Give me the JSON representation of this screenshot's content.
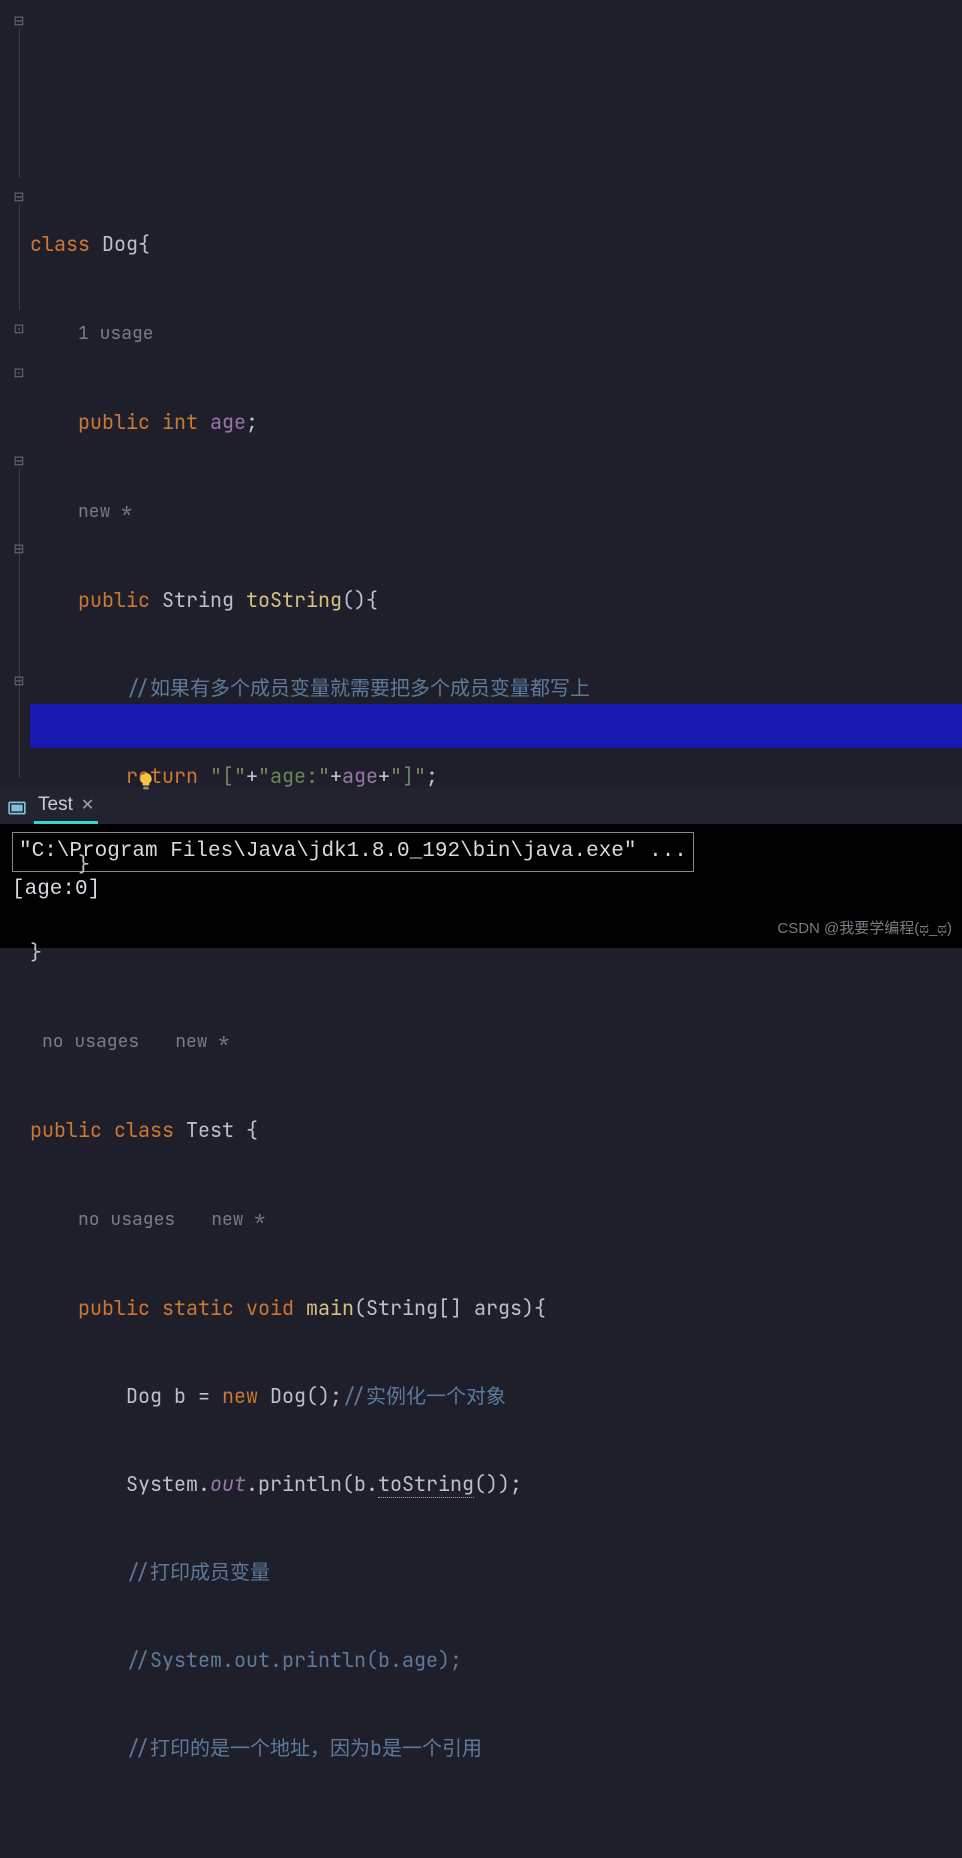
{
  "code": {
    "l1": {
      "kw": "class",
      "name": "Dog",
      "brace": "{"
    },
    "l2": {
      "hint": "1 usage"
    },
    "l3": {
      "pub": "public",
      "type": "int",
      "field": "age",
      "end": ";"
    },
    "l4": {
      "hint": "new *"
    },
    "l5": {
      "pub": "public",
      "type": "String",
      "method": "toString",
      "paren": "(){"
    },
    "l6": {
      "comment": "//如果有多个成员变量就需要把多个成员变量都写上"
    },
    "l7": {
      "kw": "return",
      "s1": "\"[\"",
      "plus1": "+",
      "s2": "\"age:\"",
      "plus2": "+",
      "field": "age",
      "plus3": "+",
      "s3": "\"]\"",
      "end": ";"
    },
    "l8": {
      "brace": "}"
    },
    "l9": {
      "brace": "}"
    },
    "l10": {
      "hint1": "no usages",
      "hint2": "new *"
    },
    "l11": {
      "pub": "public",
      "cls": "class",
      "name": "Test",
      "brace": " {"
    },
    "l12": {
      "hint1": "no usages",
      "hint2": "new *"
    },
    "l13": {
      "pub": "public",
      "static": "static",
      "void": "void",
      "method": "main",
      "args": "(String[] args){"
    },
    "l14": {
      "t1": "Dog b = ",
      "kw": "new",
      "t2": " Dog();",
      "comment": "//实例化一个对象"
    },
    "l15": {
      "t1": "System.",
      "out": "out",
      "t2": ".println(b.",
      "warn": "toString",
      "t3": "());"
    },
    "l16": {
      "comment": "//打印成员变量"
    },
    "l17": {
      "comment": "//System.out.println(b.age);"
    },
    "l18": {
      "comment": "//打印的是一个地址，因为b是一个引用"
    }
  },
  "tab": {
    "name": "Test",
    "close": "✕"
  },
  "console": {
    "cmd": "\"C:\\Program Files\\Java\\jdk1.8.0_192\\bin\\java.exe\" ...",
    "out": "[age:0]"
  },
  "watermark": "CSDN @我要学编程(ಥ_ಥ)"
}
